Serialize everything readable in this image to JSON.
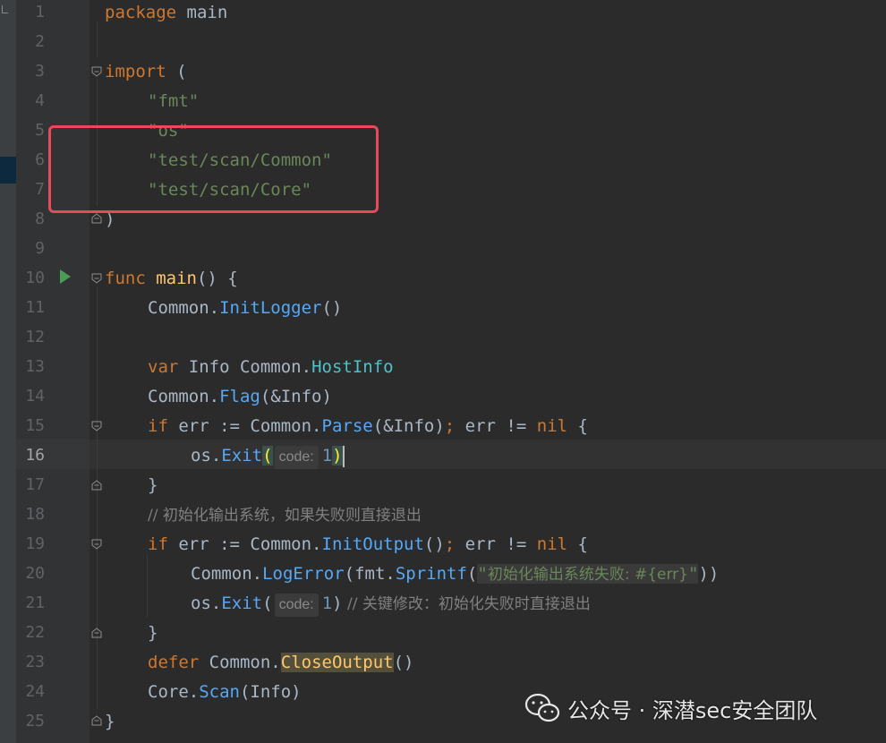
{
  "editor": {
    "current_line": "16",
    "line_numbers": [
      "1",
      "2",
      "3",
      "4",
      "5",
      "6",
      "7",
      "8",
      "9",
      "10",
      "11",
      "12",
      "13",
      "14",
      "15",
      "16",
      "17",
      "18",
      "19",
      "20",
      "21",
      "22",
      "23",
      "24",
      "25"
    ],
    "lines": {
      "l1": {
        "kw": "package",
        "name": " main"
      },
      "l3": {
        "kw": "import",
        "rest": " ("
      },
      "l4": {
        "str": "\"fmt\""
      },
      "l5": {
        "str": "\"os\""
      },
      "l6": {
        "str": "\"test/scan/Common\""
      },
      "l7": {
        "str": "\"test/scan/Core\""
      },
      "l8": {
        "rest": ")"
      },
      "l10": {
        "kw": "func",
        "sp": " ",
        "fn": "main",
        "rest": "() {"
      },
      "l11": {
        "pkg": "Common",
        "dot": ".",
        "call": "InitLogger",
        "rest": "()"
      },
      "l13": {
        "kw": "var",
        "mid": " Info ",
        "pkg": "Common",
        "dot": ".",
        "type": "HostInfo"
      },
      "l14": {
        "pkg": "Common",
        "dot": ".",
        "call": "Flag",
        "rest": "(&Info)"
      },
      "l15": {
        "kw": "if",
        "a": " err := ",
        "pkg": "Common",
        "dot": ".",
        "call": "Parse",
        "b": "(&Info)",
        "semi": ";",
        "c": " err != ",
        "nil": "nil",
        "d": " {"
      },
      "l16": {
        "pkg": "os",
        "dot": ".",
        "call": "Exit",
        "open": "(",
        "hint": "code:",
        "num": "1",
        "close": ")"
      },
      "l17": {
        "rest": "}"
      },
      "l18": {
        "cmt": "// 初始化输出系统，如果失败则直接退出"
      },
      "l19": {
        "kw": "if",
        "a": " err := ",
        "pkg": "Common",
        "dot": ".",
        "call": "InitOutput",
        "b": "()",
        "semi": ";",
        "c": " err != ",
        "nil": "nil",
        "d": " {"
      },
      "l20": {
        "pkg": "Common",
        "dot": ".",
        "call": "LogError",
        "open": "(",
        "pkg2": "fmt",
        "dot2": ".",
        "call2": "Sprintf",
        "open2": "(",
        "q1": "\"",
        "str": "初始化输出系统失败: #{err}",
        "q2": "\"",
        "close": "))"
      },
      "l21": {
        "pkg": "os",
        "dot": ".",
        "call": "Exit",
        "open": "(",
        "hint": "code:",
        "num": "1",
        "close": ")",
        "cmt": " // 关键修改：初始化失败时直接退出"
      },
      "l22": {
        "rest": "}"
      },
      "l23": {
        "kw": "defer",
        "sp": " ",
        "pkg": "Common",
        "dot": ".",
        "fn": "CloseOutput",
        "rest": "()"
      },
      "l24": {
        "pkg": "Core",
        "dot": ".",
        "call": "Scan",
        "rest": "(Info)"
      },
      "l25": {
        "rest": "}"
      }
    }
  },
  "watermark": {
    "icon": "wechat-icon",
    "text": "公众号 · 深潜sec安全团队"
  },
  "colors": {
    "background": "#2b2b2b",
    "keyword": "#cc7832",
    "string": "#6a8759",
    "function": "#ffc66d",
    "method": "#57a8f5",
    "highlight_box": "#e9495a"
  }
}
